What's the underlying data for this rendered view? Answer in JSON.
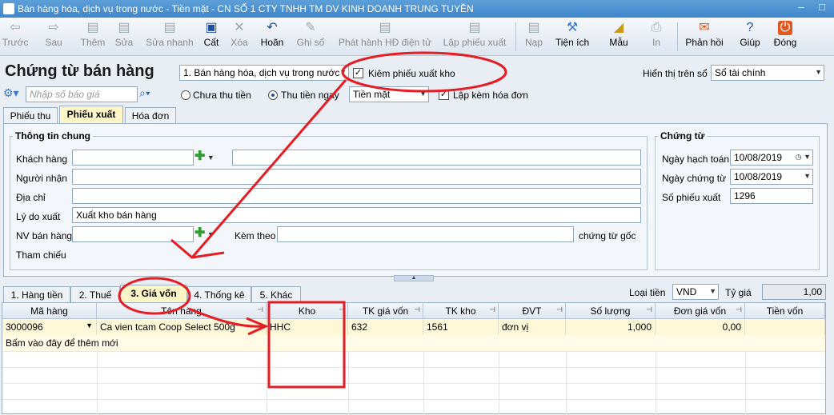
{
  "window": {
    "title": "Bán hàng hóa, dịch vụ trong nước - Tiền mặt - CN SỐ 1 CTY TNHH TM DV KINH DOANH TRUNG TUYỀN"
  },
  "toolbar": [
    {
      "label": "Trước",
      "icon": "arrow-left-icon",
      "enabled": false
    },
    {
      "label": "Sau",
      "icon": "arrow-right-icon",
      "enabled": false
    },
    {
      "label": "Thêm",
      "icon": "add-document-icon",
      "enabled": false
    },
    {
      "label": "Sửa",
      "icon": "edit-icon",
      "enabled": false
    },
    {
      "label": "Sửa nhanh",
      "icon": "quick-edit-icon",
      "enabled": false
    },
    {
      "label": "Cất",
      "icon": "save-icon",
      "enabled": true
    },
    {
      "label": "Xóa",
      "icon": "delete-icon",
      "enabled": false
    },
    {
      "label": "Hoãn",
      "icon": "undo-icon",
      "enabled": true
    },
    {
      "label": "Ghi sổ",
      "icon": "post-icon",
      "enabled": false
    },
    {
      "label": "Phát hành HĐ điện tử",
      "icon": "einvoice-icon",
      "enabled": false
    },
    {
      "label": "Lập phiếu xuất",
      "icon": "issue-slip-icon",
      "enabled": false
    },
    {
      "label": "Nạp",
      "icon": "reload-icon",
      "enabled": false
    },
    {
      "label": "Tiện ích",
      "icon": "utilities-icon",
      "enabled": true
    },
    {
      "label": "Mẫu",
      "icon": "template-icon",
      "enabled": true
    },
    {
      "label": "In",
      "icon": "print-icon",
      "enabled": false
    },
    {
      "label": "Phản hồi",
      "icon": "feedback-icon",
      "enabled": true
    },
    {
      "label": "Giúp",
      "icon": "help-icon",
      "enabled": true
    },
    {
      "label": "Đóng",
      "icon": "close-icon",
      "enabled": true
    }
  ],
  "header": {
    "title": "Chứng từ bán hàng",
    "transaction_type": "1. Bán hàng hóa, dịch vụ trong nước",
    "kiem_phieu_xuat_kho": "Kiêm phiếu xuất kho",
    "hien_thi_label": "Hiển thị trên sổ",
    "hien_thi_value": "Sổ tài chính",
    "quote_placeholder": "Nhập số báo giá",
    "chua_thu_tien": "Chưa thu tiền",
    "thu_tien_ngay": "Thu tiền ngay",
    "payment_method": "Tiền mặt",
    "lap_kem_hoa_don": "Lập kèm hóa đơn"
  },
  "doc_tabs": [
    "Phiếu thu",
    "Phiếu xuất",
    "Hóa đơn"
  ],
  "general": {
    "title": "Thông tin chung",
    "khach_hang": "Khách hàng",
    "nguoi_nhan": "Người nhận",
    "dia_chi": "Địa chỉ",
    "ly_do_xuat": "Lý do xuất",
    "ly_do_xuat_value": "Xuất kho bán hàng",
    "nv_ban_hang": "NV bán hàng",
    "kem_theo": "Kèm theo",
    "chung_tu_goc": "chứng từ gốc",
    "tham_chieu": "Tham chiếu"
  },
  "voucher": {
    "title": "Chứng từ",
    "ngay_hach_toan": "Ngày hạch toán",
    "ngay_hach_toan_value": "10/08/2019",
    "ngay_chung_tu": "Ngày chứng từ",
    "ngay_chung_tu_value": "10/08/2019",
    "so_phieu_xuat": "Số phiếu xuất",
    "so_phieu_xuat_value": "1296"
  },
  "detail_tabs": [
    "1. Hàng tiền",
    "2. Thuế",
    "3. Giá vốn",
    "4. Thống kê",
    "5. Khác"
  ],
  "currency": {
    "label": "Loại tiền",
    "value": "VND",
    "rate_label": "Tỷ giá",
    "rate_value": "1,00"
  },
  "grid": {
    "columns": [
      "Mã hàng",
      "Tên hàng",
      "Kho",
      "TK giá vốn",
      "TK kho",
      "ĐVT",
      "Số lượng",
      "Đơn giá vốn",
      "Tiền vốn"
    ],
    "rows": [
      [
        "3000096",
        "Ca vien tcam Coop Select 500g",
        "HHC",
        "632",
        "1561",
        "đơn vị",
        "1,000",
        "0,00",
        ""
      ]
    ],
    "add_new_hint": "Bấm vào đây để thêm mới"
  },
  "colors": {
    "title_bar": "#3f86cc",
    "active_tab": "#fff6c8",
    "grid_row": "#fff8d8",
    "annotation": "#e51c23"
  }
}
